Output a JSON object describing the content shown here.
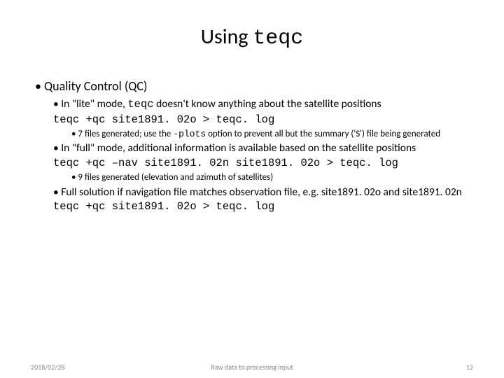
{
  "title": {
    "prefix": "Using ",
    "code": "teqc"
  },
  "h1": "Quality Control (QC)",
  "lite": {
    "pre": "In \"lite\" mode, ",
    "code": "teqc",
    "post": " doesn't know anything about the satellite positions"
  },
  "cmd1": "teqc +qc site1891. 02o > teqc. log",
  "lite_sub": {
    "pre": "7 files generated; use the ",
    "code": "-plots",
    "post": " option to prevent all but the summary ('S') file being generated"
  },
  "full": "In \"full\" mode, additional information is available based on the satellite positions",
  "cmd2": "teqc +qc –nav site1891. 02n site1891. 02o > teqc. log",
  "full_sub": "9 files generated (elevation and azimuth of satellites)",
  "match": "Full solution if navigation file matches observation file, e.g. site1891. 02o and site1891. 02n",
  "cmd3": "teqc +qc site1891. 02o > teqc. log",
  "footer": {
    "date": "2018/02/28",
    "center": "Raw data to processing input",
    "page": "12"
  }
}
